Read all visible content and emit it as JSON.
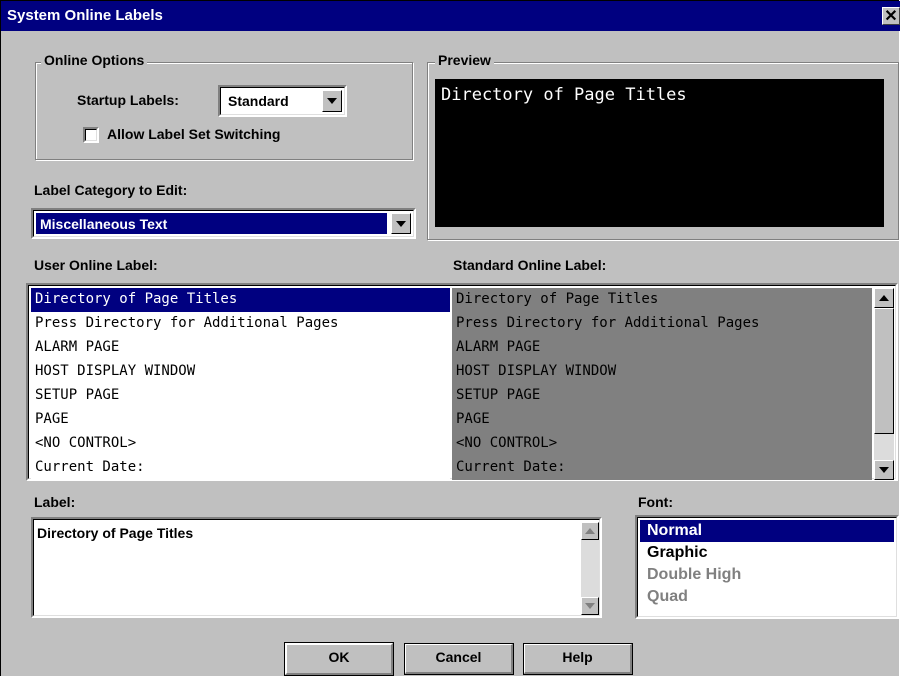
{
  "window": {
    "title": "System Online Labels",
    "close_glyph": "✕"
  },
  "online_options": {
    "group_label": "Online Options",
    "startup_label": "Startup Labels:",
    "startup_value": "Standard",
    "allow_switching_label": "Allow Label Set Switching",
    "allow_switching_checked": false
  },
  "preview": {
    "group_label": "Preview",
    "text": "Directory of Page Titles"
  },
  "category": {
    "label": "Label Category to Edit:",
    "value": "Miscellaneous Text"
  },
  "user_list": {
    "label": "User Online Label:",
    "items": [
      "Directory of Page Titles",
      "Press Directory for Additional Pages",
      "ALARM PAGE",
      "HOST DISPLAY WINDOW",
      "SETUP PAGE",
      "PAGE",
      "<NO CONTROL>",
      "Current Date:"
    ],
    "selected_index": 0
  },
  "standard_list": {
    "label": "Standard Online Label:",
    "items": [
      "Directory of Page Titles",
      "Press Directory for Additional Pages",
      "ALARM PAGE",
      "HOST DISPLAY WINDOW",
      "SETUP PAGE",
      "PAGE",
      "<NO CONTROL>",
      "Current Date:"
    ]
  },
  "label_edit": {
    "label": "Label:",
    "value": "Directory of Page Titles"
  },
  "font": {
    "label": "Font:",
    "options": [
      {
        "name": "Normal",
        "enabled": true,
        "selected": true
      },
      {
        "name": "Graphic",
        "enabled": true,
        "selected": false
      },
      {
        "name": "Double High",
        "enabled": false,
        "selected": false
      },
      {
        "name": "Quad",
        "enabled": false,
        "selected": false
      }
    ]
  },
  "buttons": {
    "ok": "OK",
    "cancel": "Cancel",
    "help": "Help"
  },
  "colors": {
    "title_bar": "#000080",
    "face": "#c0c0c0",
    "selection": "#000080",
    "standard_list_bg": "#808080",
    "preview_bg": "#000000",
    "disabled_text": "#808080"
  }
}
